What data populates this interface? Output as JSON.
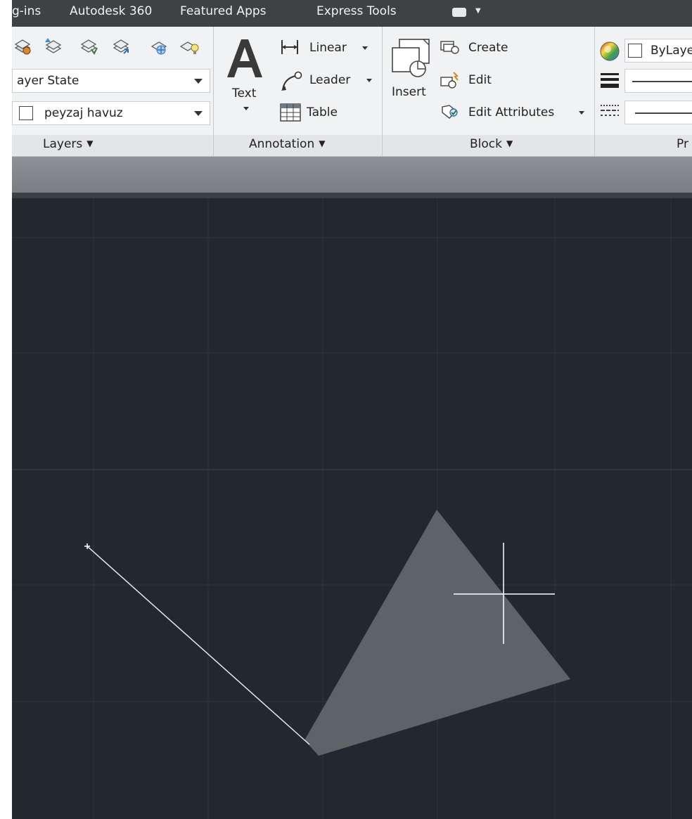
{
  "tabs": [
    {
      "label": "g-ins"
    },
    {
      "label": "Autodesk 360"
    },
    {
      "label": "Featured Apps"
    },
    {
      "label": "Express Tools"
    }
  ],
  "layers": {
    "layer_state": "ayer State",
    "current_layer": "peyzaj havuz",
    "title": "Layers"
  },
  "annotation": {
    "text_label": "Text",
    "linear_label": "Linear",
    "leader_label": "Leader",
    "table_label": "Table",
    "title": "Annotation"
  },
  "block": {
    "insert_label": "Insert",
    "create_label": "Create",
    "edit_label": "Edit",
    "edit_attributes_label": "Edit Attributes",
    "title": "Block"
  },
  "properties": {
    "color_value": "ByLaye",
    "title": "Pr"
  },
  "colors": {
    "canvas_bg": "#212830",
    "shape_fill": "#5e6368",
    "crosshair": "#ffffff"
  }
}
